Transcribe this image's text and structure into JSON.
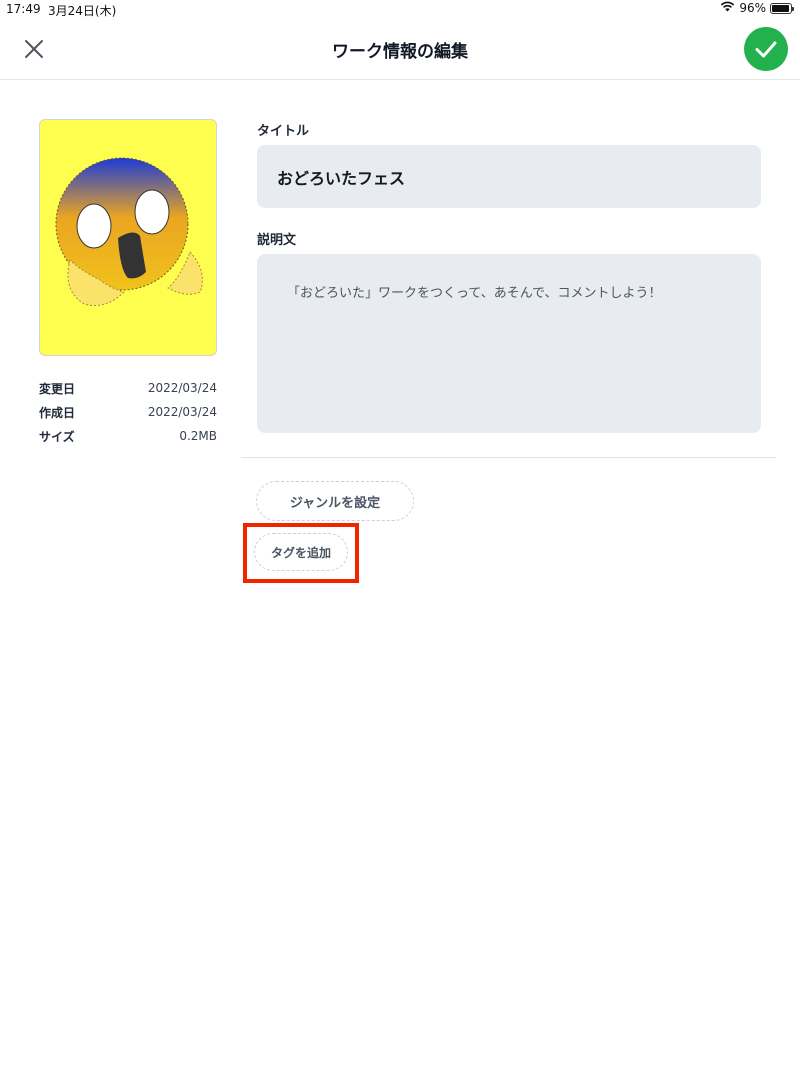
{
  "status_bar": {
    "time": "17:49",
    "date": "3月24日(木)",
    "battery": "96%",
    "battery_level": 0.96
  },
  "nav": {
    "title": "ワーク情報の編集",
    "close_icon": "close-icon",
    "confirm_icon": "checkmark-icon",
    "confirm_color": "#22b14c"
  },
  "thumbnail": {
    "icon": "screaming-face-emoji",
    "background": "#fdfe4d"
  },
  "meta": {
    "modified_label": "変更日",
    "modified_value": "2022/03/24",
    "created_label": "作成日",
    "created_value": "2022/03/24",
    "size_label": "サイズ",
    "size_value": "0.2MB"
  },
  "form": {
    "title_label": "タイトル",
    "title_value": "おどろいたフェス",
    "description_label": "説明文",
    "description_value": "「おどろいた」ワークをつくって、あそんで、コメントしよう！"
  },
  "chips": {
    "genre": "ジャンルを設定",
    "tag": "タグを追加"
  },
  "highlight_color": "#f22400"
}
